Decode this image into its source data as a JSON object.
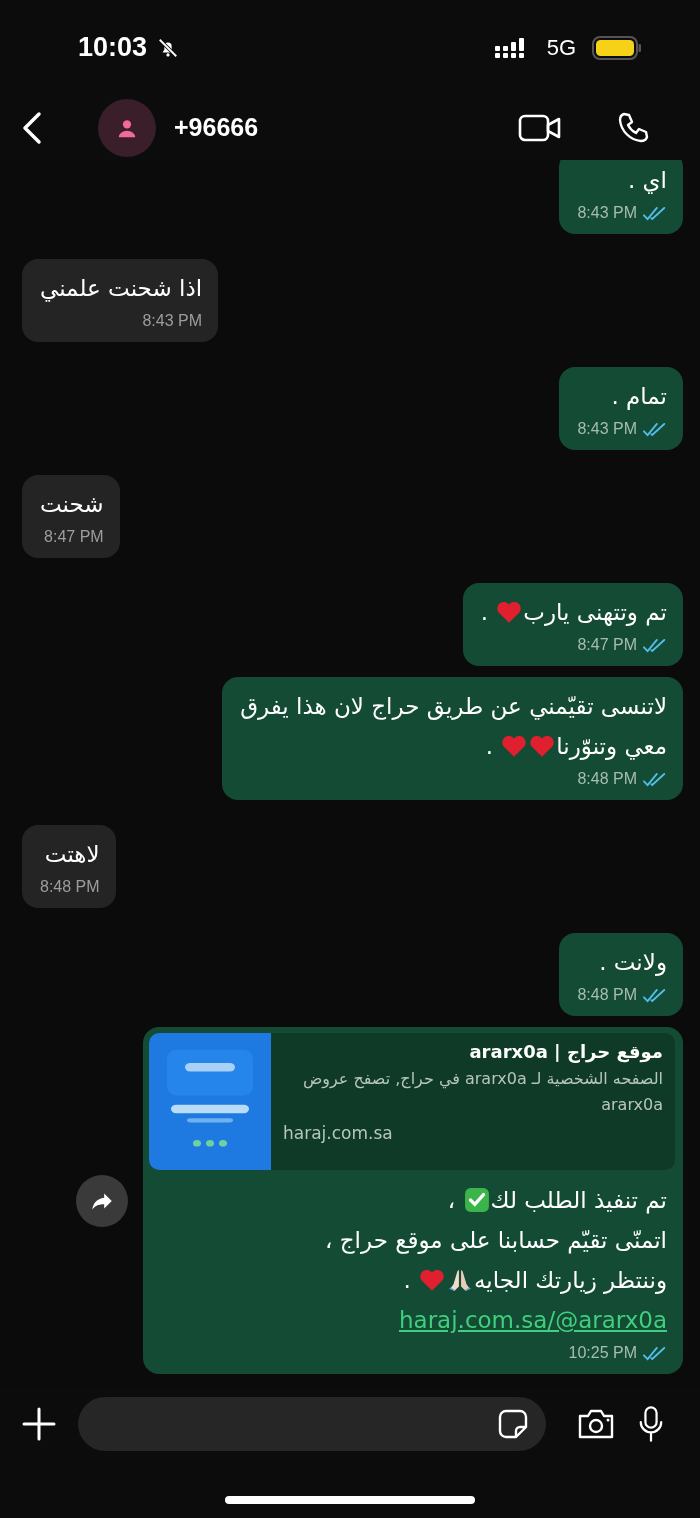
{
  "status_bar": {
    "time": "10:03",
    "network": "5G"
  },
  "header": {
    "contact": "+96666"
  },
  "messages": [
    {
      "kind": "sent",
      "parts": [
        {
          "kind": "text",
          "text": "اي ."
        }
      ],
      "time": "8:43 PM"
    },
    {
      "kind": "received",
      "parts": [
        {
          "kind": "text",
          "text": "اذا شحنت علمني"
        }
      ],
      "time": "8:43 PM"
    },
    {
      "kind": "sent",
      "parts": [
        {
          "kind": "text",
          "text": "تمام ."
        }
      ],
      "time": "8:43 PM"
    },
    {
      "kind": "received",
      "parts": [
        {
          "kind": "text",
          "text": "شحنت"
        }
      ],
      "time": "8:47 PM"
    },
    {
      "kind": "sent",
      "parts": [
        {
          "kind": "text",
          "text": "تم وتتهنى يارب"
        },
        {
          "kind": "heart"
        },
        {
          "kind": "text",
          "text": " ."
        }
      ],
      "time": "8:47 PM"
    },
    {
      "kind": "sent",
      "parts": [
        {
          "kind": "text",
          "text": "لاتنسى تقيّمني عن طريق حراج لان هذا يفرق"
        },
        {
          "kind": "break"
        },
        {
          "kind": "text",
          "text": "معي وتنوّرنا"
        },
        {
          "kind": "heart"
        },
        {
          "kind": "heart"
        },
        {
          "kind": "text",
          "text": " ."
        }
      ],
      "time": "8:48 PM"
    },
    {
      "kind": "received",
      "parts": [
        {
          "kind": "text",
          "text": "لاهتت"
        }
      ],
      "time": "8:48 PM"
    },
    {
      "kind": "sent",
      "parts": [
        {
          "kind": "text",
          "text": "ولانت ."
        }
      ],
      "time": "8:48 PM"
    },
    {
      "kind": "sent",
      "forward": true,
      "preview": {
        "title": "موقع حراج | ararx0a",
        "description": "الصفحه الشخصية لـ ararx0a في حراج, تصفح عروض ararx0a",
        "domain": "haraj.com.sa"
      },
      "parts": [
        {
          "kind": "text",
          "text": "تم تنفيذ الطلب لك"
        },
        {
          "kind": "check"
        },
        {
          "kind": "text",
          "text": " ،"
        },
        {
          "kind": "break"
        },
        {
          "kind": "text",
          "text": "اتمنّى تقيّم حسابنا على موقع حراج ،"
        },
        {
          "kind": "break"
        },
        {
          "kind": "text",
          "text": "وننتظر زيارتك الجايه"
        },
        {
          "kind": "pray"
        },
        {
          "kind": "heart"
        },
        {
          "kind": "text",
          "text": " ."
        },
        {
          "kind": "break"
        },
        {
          "kind": "link",
          "text": "haraj.com.sa/@ararx0a"
        }
      ],
      "time": "10:25 PM"
    }
  ]
}
